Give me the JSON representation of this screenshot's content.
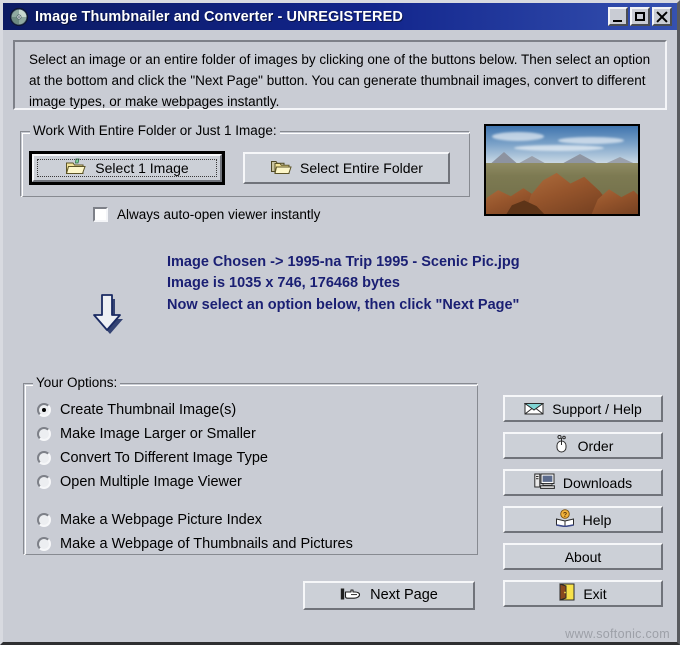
{
  "window": {
    "title": "Image Thumbnailer and Converter - UNREGISTERED",
    "icon": "cd-disc-icon",
    "controls": {
      "minimize": "Minimize",
      "maximize": "Maximize",
      "close": "Close"
    }
  },
  "instructions": {
    "text": "Select an image or an entire folder of images by clicking one of the buttons below. Then select an option at the bottom and click the \"Next Page\" button. You can generate thumbnail images, convert to different image types, or make webpages instantly."
  },
  "folder_group": {
    "title": "Work With Entire Folder or Just 1 Image:",
    "select_image_label": "Select 1 Image",
    "select_folder_label": "Select Entire Folder"
  },
  "auto_open": {
    "label": "Always auto-open viewer instantly",
    "checked": false
  },
  "status": {
    "line1": "Image Chosen -> 1995-na Trip 1995 - Scenic Pic.jpg",
    "line2": "Image is 1035 x 746, 176468 bytes",
    "line3": "Now select an option below, then click \"Next Page\"",
    "color": "#1a1f73",
    "arrow_icon": "down-arrow-icon"
  },
  "preview": {
    "alt": "Scenic desert rock landscape thumbnail"
  },
  "options_group": {
    "title": "Your Options:",
    "items": [
      {
        "label": "Create Thumbnail Image(s)",
        "checked": true,
        "spaced": false
      },
      {
        "label": "Make Image Larger or Smaller",
        "checked": false,
        "spaced": false
      },
      {
        "label": "Convert To Different Image Type",
        "checked": false,
        "spaced": false
      },
      {
        "label": "Open Multiple Image Viewer",
        "checked": false,
        "spaced": false
      },
      {
        "label": "Make a Webpage Picture Index",
        "checked": false,
        "spaced": true
      },
      {
        "label": "Make a Webpage of Thumbnails and Pictures",
        "checked": false,
        "spaced": false
      }
    ]
  },
  "side_buttons": [
    {
      "label": "Support / Help",
      "icon": "envelope-icon"
    },
    {
      "label": "Order",
      "icon": "mouse-icon"
    },
    {
      "label": "Downloads",
      "icon": "computer-icon"
    },
    {
      "label": "Help",
      "icon": "open-book-question-icon"
    },
    {
      "label": "About",
      "icon": "none"
    },
    {
      "label": "Exit",
      "icon": "open-door-icon"
    }
  ],
  "next_page": {
    "label": "Next Page",
    "icon": "pointing-hand-icon"
  },
  "watermark": {
    "text": "www.softonic.com"
  }
}
